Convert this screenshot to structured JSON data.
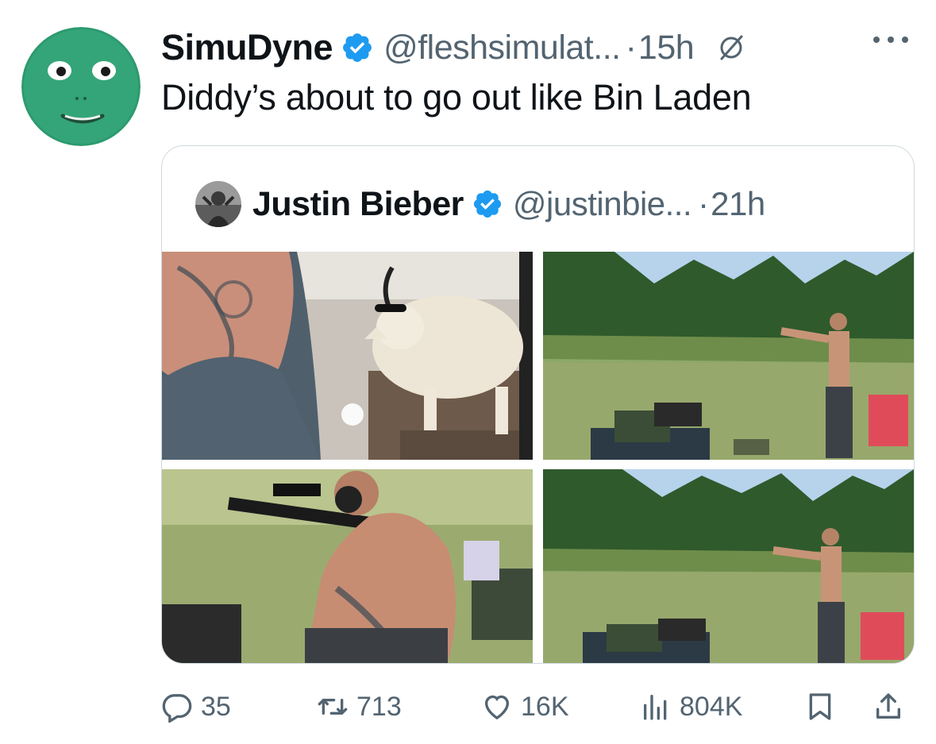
{
  "tweet": {
    "author_name": "SimuDyne",
    "handle": "@fleshsimulat...",
    "separator": "·",
    "time": "15h",
    "text": "Diddy’s about to go out like Bin Laden"
  },
  "quoted_tweet": {
    "author_name": "Justin Bieber",
    "handle": "@justinbie...",
    "separator": "·",
    "time": "21h"
  },
  "stats": {
    "replies": "35",
    "retweets": "713",
    "likes": "16K",
    "views": "804K"
  },
  "colors": {
    "text_primary": "#0f1419",
    "text_secondary": "#536471",
    "verified_blue": "#1d9bf0",
    "border": "#cfd9de"
  },
  "icons": [
    "verified-badge-icon",
    "grok-icon",
    "more-icon",
    "reply-icon",
    "retweet-icon",
    "like-icon",
    "views-icon",
    "bookmark-icon",
    "share-icon"
  ]
}
